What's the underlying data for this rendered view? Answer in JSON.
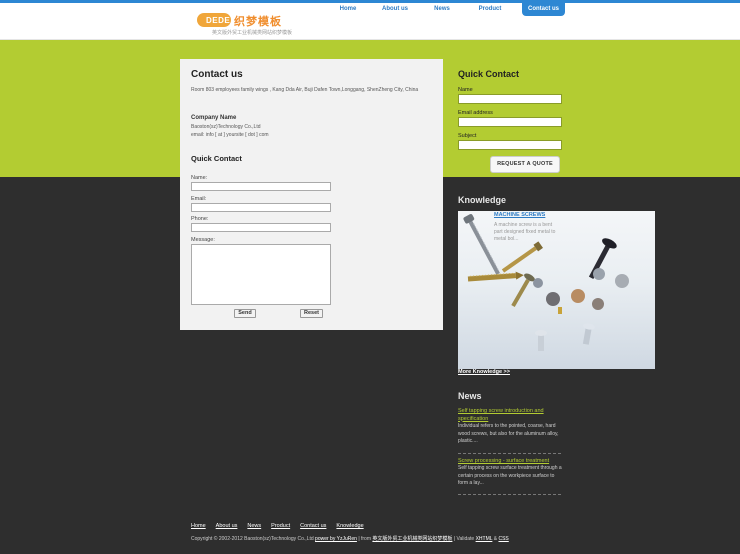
{
  "colors": {
    "accent_blue": "#2d87d3",
    "brand_green": "#b3cc32",
    "dark_bg": "#2e2e2e",
    "panel_bg": "#f2f2f2",
    "logo_orange": "#f0a63a"
  },
  "header": {
    "logo_badge": "DEDE",
    "logo_cn": "织梦模板",
    "logo_sub": "英文版外贸工业机械类网站织梦模板",
    "nav": [
      {
        "label": "Home",
        "active": false
      },
      {
        "label": "About us",
        "active": false
      },
      {
        "label": "News",
        "active": false
      },
      {
        "label": "Product",
        "active": false
      },
      {
        "label": "Contact us",
        "active": true
      }
    ]
  },
  "contact": {
    "title": "Contact us",
    "address": "Room 803 employees family wings , Kang Dda Air, Buji Dafen Town,Longgang, ShenZheng City, China",
    "company_label": "Company Name",
    "company_name": "Baoston(sz)Technology Co.,Ltd",
    "email": "email: info [ at ] yoursite [ dot ] com",
    "form_title": "Quick Contact",
    "name_label": "Name:",
    "email_label": "Email:",
    "phone_label": "Phone:",
    "message_label": "Message:",
    "send_label": "Send",
    "reset_label": "Reset"
  },
  "sidebar": {
    "quick_contact": {
      "title": "Quick Contact",
      "name_label": "Name",
      "email_label": "Email address",
      "subject_label": "Subject",
      "button_label": "REQUEST A QUOTE"
    },
    "knowledge": {
      "title": "Knowledge",
      "item_title": "MACHINE SCREWS",
      "item_desc": "A machine screw is a bent part designed fixed metal to metal bol...",
      "image_icon": "screws-photo",
      "more_label": "More Knowledge >>"
    },
    "news": {
      "title": "News",
      "items": [
        {
          "title": "Self tapping screw introduction and specification",
          "desc": "Individual refers to the pointed, coarse, hard wood screws, but also for the aluminum alloy, plastic...."
        },
        {
          "title": "Screw processing - surface treatment",
          "desc": "Self tapping screw surface treatment through a certain process on the workpiece surface to form a lay..."
        }
      ]
    }
  },
  "footer": {
    "links": [
      "Home",
      "About us",
      "News",
      "Product",
      "Contact us",
      "Knowledge"
    ],
    "copy_prefix": "Copyright © 2002-2012 Baoston(sz)Technology Co.,Ltd",
    "power_link": "power by YzJuRen",
    "from_text": "| from",
    "template_link": "英文版外贸工业机械类网站织梦模板",
    "validate_text": "| Validate",
    "xhtml_link": "XHTML",
    "amp": "&",
    "css_link": "CSS"
  }
}
